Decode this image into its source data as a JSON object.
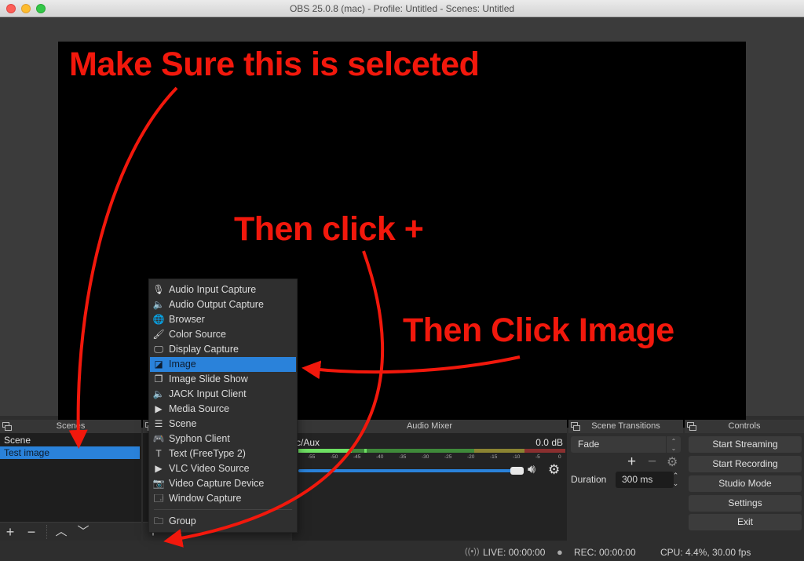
{
  "window": {
    "title": "OBS 25.0.8 (mac) - Profile: Untitled - Scenes: Untitled"
  },
  "scenes_dock": {
    "header": "Scenes",
    "items": [
      {
        "label": "Scene",
        "selected": false
      },
      {
        "label": "Test image",
        "selected": true
      }
    ],
    "toolbar": {
      "add": "+",
      "remove": "−",
      "up": "^",
      "down": "v"
    }
  },
  "add_source_menu": {
    "items": [
      {
        "label": "Audio Input Capture",
        "icon": "microphone-icon",
        "glyph": "🎙",
        "selected": false
      },
      {
        "label": "Audio Output Capture",
        "icon": "speaker-icon",
        "glyph": "🔈",
        "selected": false
      },
      {
        "label": "Browser",
        "icon": "globe-icon",
        "glyph": "🌐",
        "selected": false
      },
      {
        "label": "Color Source",
        "icon": "paintbrush-icon",
        "glyph": "🖌",
        "selected": false
      },
      {
        "label": "Display Capture",
        "icon": "monitor-icon",
        "glyph": "🖵",
        "selected": false
      },
      {
        "label": "Image",
        "icon": "image-icon",
        "glyph": "◪",
        "selected": true
      },
      {
        "label": "Image Slide Show",
        "icon": "slideshow-icon",
        "glyph": "❐",
        "selected": false
      },
      {
        "label": "JACK Input Client",
        "icon": "speaker-icon",
        "glyph": "🔈",
        "selected": false
      },
      {
        "label": "Media Source",
        "icon": "play-icon",
        "glyph": "▶",
        "selected": false
      },
      {
        "label": "Scene",
        "icon": "list-icon",
        "glyph": "☰",
        "selected": false
      },
      {
        "label": "Syphon Client",
        "icon": "gamepad-icon",
        "glyph": "🎮",
        "selected": false
      },
      {
        "label": "Text (FreeType 2)",
        "icon": "text-icon",
        "glyph": "T",
        "selected": false
      },
      {
        "label": "VLC Video Source",
        "icon": "play-icon",
        "glyph": "▶",
        "selected": false
      },
      {
        "label": "Video Capture Device",
        "icon": "camera-icon",
        "glyph": "📷",
        "selected": false
      },
      {
        "label": "Window Capture",
        "icon": "window-icon",
        "glyph": "🗔",
        "selected": false
      }
    ],
    "group_item": {
      "label": "Group",
      "icon": "folder-icon",
      "glyph": "🗀"
    }
  },
  "audio_mixer": {
    "header": "Audio Mixer",
    "channel_name": "c/Aux",
    "level": "0.0 dB",
    "meter_ticks": [
      "-55",
      "-50",
      "-45",
      "-40",
      "-35",
      "-30",
      "-25",
      "-20",
      "-15",
      "-10",
      "-5",
      "0"
    ],
    "volume_fraction": 1.0
  },
  "scene_transitions": {
    "header": "Scene Transitions",
    "transition": "Fade",
    "duration_label": "Duration",
    "duration_value": "300 ms"
  },
  "controls": {
    "header": "Controls",
    "buttons": [
      "Start Streaming",
      "Start Recording",
      "Studio Mode",
      "Settings",
      "Exit"
    ]
  },
  "status_bar": {
    "live": "LIVE: 00:00:00",
    "rec": "REC: 00:00:00",
    "cpu": "CPU: 4.4%, 30.00 fps"
  },
  "annotations": {
    "step1": "Make Sure this is selceted",
    "step2": "Then click +",
    "step3": "Then Click Image",
    "color": "#f2180c"
  }
}
